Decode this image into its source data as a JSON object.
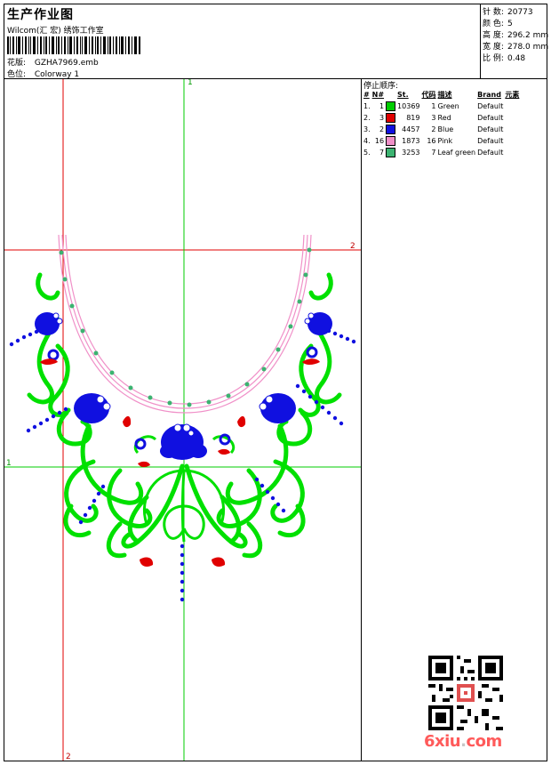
{
  "header": {
    "title": "生产作业图",
    "company": "Wilcom(汇 宏) 绣饰工作室",
    "design_label": "花版:",
    "design_file": "GZHA7969.emb",
    "colorway_label": "色位:",
    "colorway": "Colorway 1"
  },
  "stats": {
    "stitches_label": "针 数:",
    "stitches": "20773",
    "colors_label": "颜 色:",
    "colors": "5",
    "height_label": "高 度:",
    "height": "296.2 mm",
    "width_label": "宽 度:",
    "width": "278.0 mm",
    "scale_label": "比 例:",
    "scale": "0.48"
  },
  "stop_sequence": {
    "title": "停止顺序:",
    "columns": [
      "#",
      "N#",
      "St.",
      "代码",
      "描述",
      "Brand",
      "元素"
    ],
    "rows": [
      {
        "idx": "1.",
        "n": "1",
        "color": "#00cc00",
        "st": "10369",
        "code": "1",
        "desc": "Green",
        "brand": "Default"
      },
      {
        "idx": "2.",
        "n": "3",
        "color": "#e00000",
        "st": "819",
        "code": "3",
        "desc": "Red",
        "brand": "Default"
      },
      {
        "idx": "3.",
        "n": "2",
        "color": "#1010e0",
        "st": "4457",
        "code": "2",
        "desc": "Blue",
        "brand": "Default"
      },
      {
        "idx": "4.",
        "n": "16",
        "color": "#f090c8",
        "st": "1873",
        "code": "16",
        "desc": "Pink",
        "brand": "Default"
      },
      {
        "idx": "5.",
        "n": "7",
        "color": "#3cb371",
        "st": "3253",
        "code": "7",
        "desc": "Leaf green",
        "brand": "Default"
      }
    ]
  },
  "guides": {
    "green_v_label": "1",
    "green_h_label": "1",
    "red_h_label": "2",
    "red_v_label": "2"
  },
  "watermark": {
    "text": "6xiu",
    "dot": ".",
    "tld": "com"
  }
}
